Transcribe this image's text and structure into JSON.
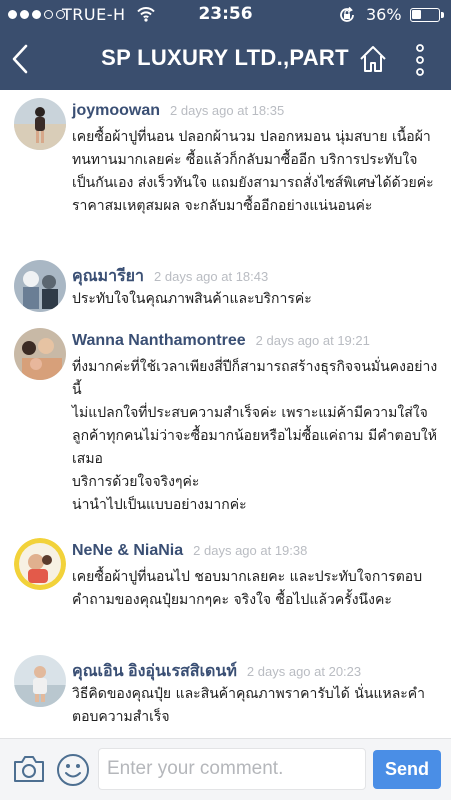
{
  "status_bar": {
    "carrier": "TRUE-H",
    "time": "23:56",
    "battery_percent": "36%",
    "battery_level": 0.36,
    "signal_bars": 3,
    "signal_bars_total": 5
  },
  "header": {
    "title": "SP LUXURY LTD.,PART",
    "background": "#3a4e6e",
    "back_icon": "chevron-left-icon",
    "home_icon": "home-icon",
    "more_icon": "more-vertical-icon"
  },
  "comments": [
    {
      "author": "joymoowan",
      "time": "2 days ago at 18:35",
      "text": "เคยซื้อผ้าปูที่นอน ปลอกผ้านวม ปลอกหมอน นุ่มสบาย เนื้อผ้าทนทานมากเลยค่ะ ซื้อแล้วก็กลับมาซื้ออีก บริการประทับใจ เป็นกันเอง ส่งเร็วทันใจ แถมยังสามารถสั่งไซส์พิเศษได้ด้วยค่ะ ราคาสมเหตุสมผล จะกลับมาซื้ออีกอย่างแน่นอนค่ะ"
    },
    {
      "author": "คุณมารียา",
      "time": "2 days ago at 18:43",
      "text": "ประทับใจในคุณภาพสินค้าและบริการค่ะ"
    },
    {
      "author": "Wanna Nanthamontree",
      "time": "2 days ago at 19:21",
      "text": "ที่งมากค่ะที่ใช้เวลาเพียงสี่ปีก็สามารถสร้างธุรกิจจนมั่นคงอย่างนี้\nไม่แปลกใจที่ประสบความสำเร็จค่ะ เพราะแม่ค้ามีความใส่ใจลูกค้าทุกคนไม่ว่าจะซื้อมากน้อยหรือไม่ซื้อแค่ถาม มีคำตอบให้เสมอ\nบริการด้วยใจจริงๆค่ะ\nน่านำไปเป็นแบบอย่างมากค่ะ"
    },
    {
      "author": "NeNe & NiaNia",
      "time": "2 days ago at 19:38",
      "text": "เคยซื้อผ้าปูที่นอนไป ชอบมากเลยคะ และประทับใจการตอบคำถามของคุณปุ๋ยมากๆคะ จริงใจ ซื้อไปแล้วครั้งนึงคะ"
    },
    {
      "author": "คุณเอิน  อิงอุ่นเรสสิเดนท์",
      "time": "2 days ago at 20:23",
      "text": "วิธีคิดของคุณปุ๋ย และสินค้าคุณภาพราคารับได้ นั่นแหละคำตอบความสำเร็จ"
    }
  ],
  "composer": {
    "placeholder": "Enter your comment.",
    "value": "",
    "send_label": "Send",
    "camera_icon": "camera-icon",
    "emoji_icon": "smiley-icon",
    "accent": "#4a8ee6"
  }
}
